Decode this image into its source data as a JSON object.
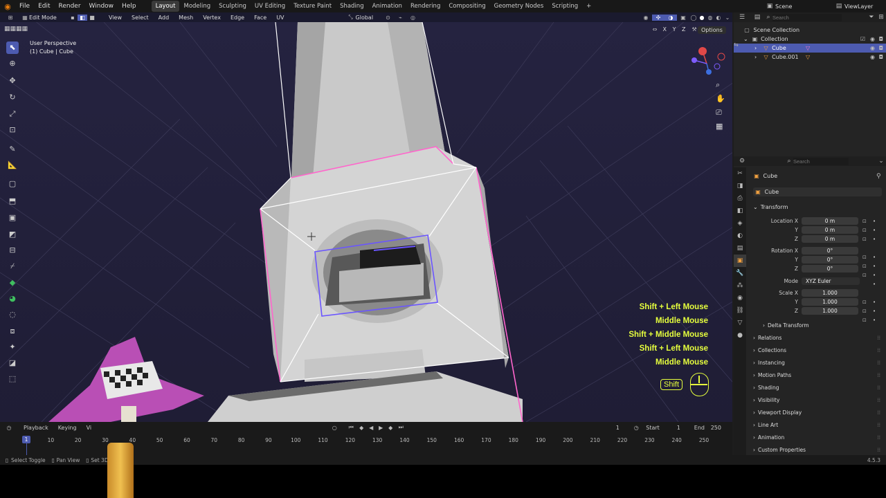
{
  "topbar": {
    "menus": [
      "File",
      "Edit",
      "Render",
      "Window",
      "Help"
    ],
    "workspaces": [
      "Layout",
      "Modeling",
      "Sculpting",
      "UV Editing",
      "Texture Paint",
      "Shading",
      "Animation",
      "Rendering",
      "Compositing",
      "Geometry Nodes",
      "Scripting"
    ],
    "active_workspace": "Layout",
    "scene": "Scene",
    "view_layer": "ViewLayer"
  },
  "viewport_header": {
    "mode": "Edit Mode",
    "menus": [
      "View",
      "Select",
      "Add",
      "Mesh",
      "Vertex",
      "Edge",
      "Face",
      "UV"
    ],
    "orientation": "Global",
    "options_label": "Options",
    "axes": [
      "X",
      "Y",
      "Z"
    ]
  },
  "viewport": {
    "perspective_label": "User Perspective",
    "object_label": "(1) Cube | Cube",
    "keys": [
      "Shift + Left Mouse",
      "Middle Mouse",
      "Shift + Middle Mouse",
      "Shift + Left Mouse",
      "Middle Mouse"
    ],
    "shift_key": "Shift",
    "key_color": "#e6ff3d",
    "selection_color": "#ff66cc",
    "face_select_color": "#6a55ff"
  },
  "timeline": {
    "playback": "Playback",
    "keying": "Keying",
    "view": "Vi",
    "current_frame": "1",
    "start_label": "Start",
    "start": "1",
    "end_label": "End",
    "end": "250",
    "ticks": [
      "1",
      "10",
      "20",
      "30",
      "40",
      "50",
      "60",
      "70",
      "80",
      "90",
      "100",
      "110",
      "120",
      "130",
      "140",
      "150",
      "160",
      "170",
      "180",
      "190",
      "200",
      "210",
      "220",
      "230",
      "240",
      "250"
    ]
  },
  "status": {
    "items": [
      "Select Toggle",
      "Pan View",
      "Set 3D"
    ],
    "version": "4.5.3"
  },
  "outliner": {
    "search_placeholder": "Search",
    "scene_collection": "Scene Collection",
    "collection": "Collection",
    "items": [
      "Cube",
      "Cube.001"
    ],
    "active_color": "#4d5bb0"
  },
  "properties": {
    "search_placeholder": "Search",
    "object_name": "Cube",
    "datablock_name": "Cube",
    "transform_title": "Transform",
    "location": {
      "label": "Location X",
      "y_label": "Y",
      "z_label": "Z",
      "x": "0 m",
      "y": "0 m",
      "z": "0 m"
    },
    "rotation": {
      "label": "Rotation X",
      "y_label": "Y",
      "z_label": "Z",
      "x": "0°",
      "y": "0°",
      "z": "0°"
    },
    "mode_label": "Mode",
    "mode_value": "XYZ Euler",
    "scale": {
      "label": "Scale X",
      "y_label": "Y",
      "z_label": "Z",
      "x": "1.000",
      "y": "1.000",
      "z": "1.000"
    },
    "delta_transform": "Delta Transform",
    "panels": [
      "Relations",
      "Collections",
      "Instancing",
      "Motion Paths",
      "Shading",
      "Visibility",
      "Viewport Display",
      "Line Art",
      "Animation",
      "Custom Properties"
    ]
  }
}
